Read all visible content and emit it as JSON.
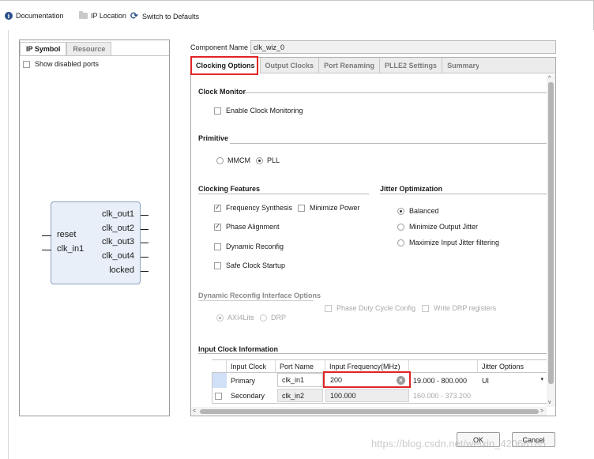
{
  "toolbar": {
    "documentation": "Documentation",
    "ip_location": "IP Location",
    "switch_defaults": "Switch to Defaults"
  },
  "left_panel": {
    "tabs": [
      "IP Symbol",
      "Resource"
    ],
    "show_disabled_ports": "Show disabled ports",
    "symbol": {
      "inputs": [
        "reset",
        "clk_in1"
      ],
      "outputs": [
        "clk_out1",
        "clk_out2",
        "clk_out3",
        "clk_out4",
        "locked"
      ]
    }
  },
  "component": {
    "label": "Component Name",
    "value": "clk_wiz_0"
  },
  "tabs": [
    "Clocking Options",
    "Output Clocks",
    "Port Renaming",
    "PLLE2 Settings",
    "Summary"
  ],
  "clock_monitor": {
    "title": "Clock Monitor",
    "enable": "Enable Clock Monitoring"
  },
  "primitive": {
    "title": "Primitive",
    "options": [
      "MMCM",
      "PLL"
    ],
    "selected": "PLL"
  },
  "clocking_features": {
    "title": "Clocking Features",
    "freq_synth": "Frequency Synthesis",
    "min_power": "Minimize Power",
    "phase_align": "Phase Alignment",
    "dyn_reconfig": "Dynamic Reconfig",
    "safe_startup": "Safe Clock Startup"
  },
  "jitter_opt": {
    "title": "Jitter Optimization",
    "options": [
      "Balanced",
      "Minimize Output Jitter",
      "Maximize Input Jitter filtering"
    ],
    "selected": "Balanced"
  },
  "dyn_reconfig_iface": {
    "title": "Dynamic Reconfig Interface Options",
    "options": [
      "AXI4Lite",
      "DRP"
    ],
    "phase_duty": "Phase Duty Cycle Config",
    "write_drp": "Write DRP registers"
  },
  "input_clock": {
    "title": "Input Clock Information",
    "headers": [
      "Input Clock",
      "Port Name",
      "Input Frequency(MHz)",
      "",
      "Jitter Options"
    ],
    "rows": [
      {
        "name": "Primary",
        "port": "clk_in1",
        "freq": "200",
        "range": "19.000 - 800.000",
        "jitter": "UI"
      },
      {
        "name": "Secondary",
        "port": "clk_in2",
        "freq": "100.000",
        "range": "160.000 - 373.200",
        "jitter": ""
      }
    ]
  },
  "buttons": {
    "ok": "OK",
    "cancel": "Cancel"
  },
  "watermark": "https://blog.csdn.net/weixin_42066185",
  "colors": {
    "highlight": "#e02424",
    "accent": "#2a4f8a"
  }
}
